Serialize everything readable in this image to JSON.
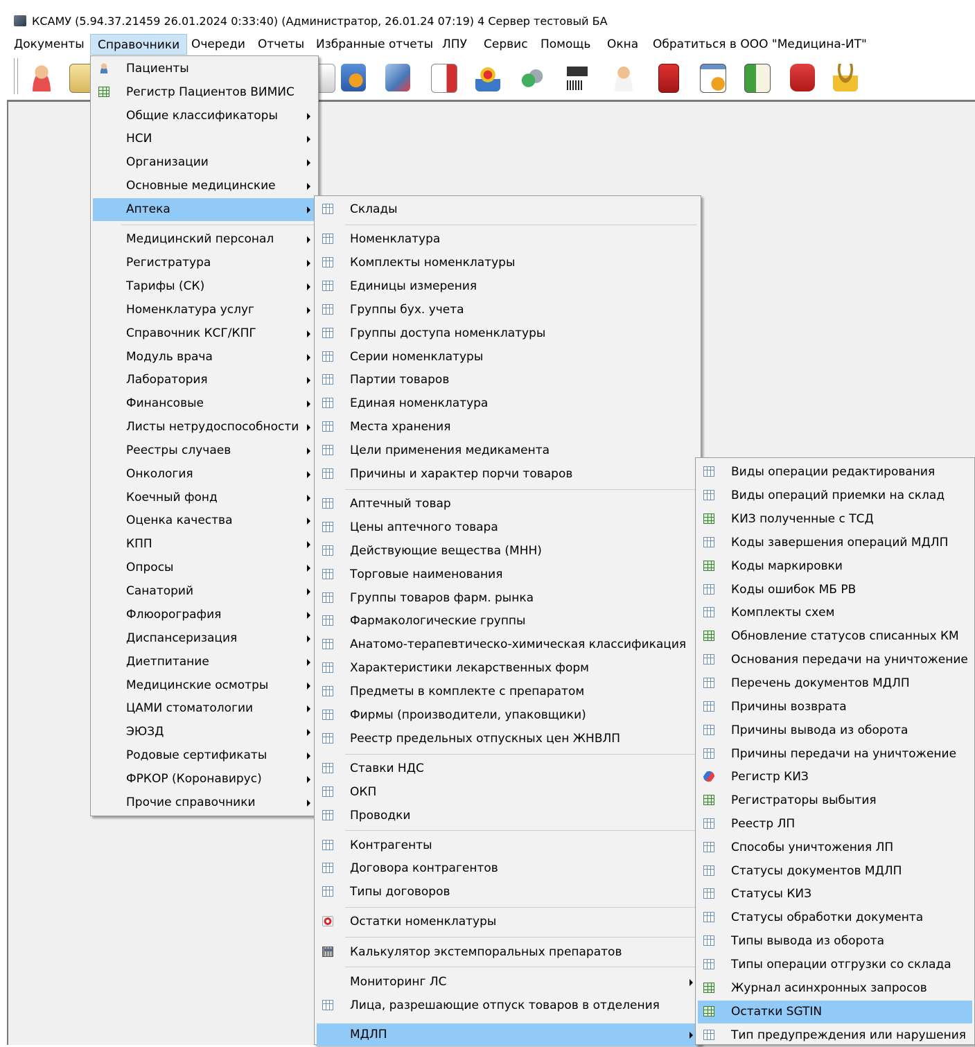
{
  "window": {
    "title": "КСАМУ (5.94.37.21459 26.01.2024 0:33:40) (Администратор, 26.01.24 07:19)  4 Сервер тестовый БА"
  },
  "menubar": [
    {
      "label": "Документы"
    },
    {
      "label": "Справочники",
      "active": true
    },
    {
      "label": "Очереди"
    },
    {
      "label": "Отчеты"
    },
    {
      "label": "Избранные отчеты"
    },
    {
      "label": "ЛПУ"
    },
    {
      "label": "Сервис"
    },
    {
      "label": "Помощь"
    },
    {
      "label": "Окна"
    },
    {
      "label": "Обратиться в ООО \"Медицина-ИТ\""
    }
  ],
  "menu1": [
    {
      "label": "Пациенты",
      "icon": "patients-icon"
    },
    {
      "label": "Регистр Пациентов ВИМИС",
      "icon": "grid-green-icon"
    },
    {
      "label": "Общие классификаторы",
      "sub": true
    },
    {
      "label": "НСИ",
      "sub": true
    },
    {
      "label": "Организации",
      "sub": true
    },
    {
      "label": "Основные медицинские",
      "sub": true
    },
    {
      "label": "Аптека",
      "sub": true,
      "selected": true
    },
    {
      "label": "Медицинский персонал",
      "sub": true
    },
    {
      "label": "Регистратура",
      "sub": true
    },
    {
      "label": "Тарифы (СК)",
      "sub": true
    },
    {
      "label": "Номенклатура услуг",
      "sub": true
    },
    {
      "label": "Справочник КСГ/КПГ",
      "sub": true
    },
    {
      "label": "Модуль врача",
      "sub": true
    },
    {
      "label": "Лаборатория",
      "sub": true
    },
    {
      "label": "Финансовые",
      "sub": true
    },
    {
      "label": "Листы нетрудоспособности",
      "sub": true
    },
    {
      "label": "Реестры случаев",
      "sub": true
    },
    {
      "label": "Онкология",
      "sub": true
    },
    {
      "label": "Коечный фонд",
      "sub": true
    },
    {
      "label": "Оценка качества",
      "sub": true
    },
    {
      "label": "КПП",
      "sub": true
    },
    {
      "label": "Опросы",
      "sub": true
    },
    {
      "label": "Санаторий",
      "sub": true
    },
    {
      "label": "Флюорография",
      "sub": true
    },
    {
      "label": "Диспансеризация",
      "sub": true
    },
    {
      "label": "Диетпитание",
      "sub": true
    },
    {
      "label": "Медицинские осмотры",
      "sub": true
    },
    {
      "label": "ЦАМИ стоматологии",
      "sub": true
    },
    {
      "label": "ЭЮЗД",
      "sub": true
    },
    {
      "label": "Родовые сертификаты",
      "sub": true
    },
    {
      "label": "ФРКОР (Коронавирус)",
      "sub": true
    },
    {
      "label": "Прочие справочники",
      "sub": true
    }
  ],
  "menu2": [
    {
      "label": "Склады",
      "icon": "grid-icon"
    },
    {
      "label": "Номенклатура",
      "icon": "grid-icon"
    },
    {
      "label": "Комплекты номенклатуры",
      "icon": "grid-icon"
    },
    {
      "label": "Единицы измерения",
      "icon": "grid-icon"
    },
    {
      "label": "Группы бух. учета",
      "icon": "grid-icon"
    },
    {
      "label": "Группы доступа номенклатуры",
      "icon": "grid-icon"
    },
    {
      "label": "Серии номенклатуры",
      "icon": "grid-icon"
    },
    {
      "label": "Партии товаров",
      "icon": "grid-icon"
    },
    {
      "label": "Единая номенклатура",
      "icon": "grid-icon"
    },
    {
      "label": "Места хранения",
      "icon": "grid-icon"
    },
    {
      "label": "Цели применения медикамента",
      "icon": "grid-icon"
    },
    {
      "label": "Причины и характер порчи товаров",
      "icon": "grid-icon"
    },
    {
      "label": "Аптечный товар",
      "icon": "grid-icon"
    },
    {
      "label": "Цены аптечного товара",
      "icon": "grid-icon"
    },
    {
      "label": "Действующие вещества (МНН)",
      "icon": "grid-icon"
    },
    {
      "label": "Торговые наименования",
      "icon": "grid-icon"
    },
    {
      "label": "Группы товаров фарм. рынка",
      "icon": "grid-icon"
    },
    {
      "label": "Фармакологические группы",
      "icon": "grid-icon"
    },
    {
      "label": "Анатомо-терапевтическо-химическая классификация",
      "icon": "grid-icon"
    },
    {
      "label": "Характеристики лекарственных форм",
      "icon": "grid-icon"
    },
    {
      "label": "Предметы в комплекте с препаратом",
      "icon": "grid-icon"
    },
    {
      "label": "Фирмы (производители, упаковщики)",
      "icon": "grid-icon"
    },
    {
      "label": "Реестр предельных отпускных цен ЖНВЛП",
      "icon": "grid-icon"
    },
    {
      "label": "Ставки НДС",
      "icon": "grid-icon"
    },
    {
      "label": "ОКП",
      "icon": "grid-icon"
    },
    {
      "label": "Проводки",
      "icon": "grid-icon"
    },
    {
      "label": "Контрагенты",
      "icon": "grid-icon"
    },
    {
      "label": "Договора контрагентов",
      "icon": "grid-icon"
    },
    {
      "label": "Типы договоров",
      "icon": "grid-icon"
    },
    {
      "label": "Остатки номенклатуры",
      "icon": "record-icon"
    },
    {
      "label": "Калькулятор экстемпоральных препаратов",
      "icon": "calculator-icon"
    },
    {
      "label": "Мониторинг ЛС",
      "sub": true
    },
    {
      "label": "Лица, разрешающие отпуск товаров в отделения",
      "icon": "grid-icon"
    },
    {
      "label": "МДЛП",
      "sub": true,
      "selected": true
    }
  ],
  "menu3": [
    {
      "label": "Виды операции редактирования",
      "icon": "grid-icon"
    },
    {
      "label": "Виды операций приемки на склад",
      "icon": "grid-icon"
    },
    {
      "label": "КИЗ полученные с ТСД",
      "icon": "grid-green-icon"
    },
    {
      "label": "Коды завершения операций МДЛП",
      "icon": "grid-icon"
    },
    {
      "label": "Коды маркировки",
      "icon": "grid-green-icon"
    },
    {
      "label": "Коды ошибок МБ РВ",
      "icon": "grid-icon"
    },
    {
      "label": "Комплекты схем",
      "icon": "grid-icon"
    },
    {
      "label": "Обновление статусов списанных КМ",
      "icon": "grid-green-icon"
    },
    {
      "label": "Основания передачи на уничтожение",
      "icon": "grid-icon"
    },
    {
      "label": "Перечень документов МДЛП",
      "icon": "grid-icon"
    },
    {
      "label": "Причины возврата",
      "icon": "grid-icon"
    },
    {
      "label": "Причины вывода из оборота",
      "icon": "grid-icon"
    },
    {
      "label": "Причины передачи на уничтожение",
      "icon": "grid-icon"
    },
    {
      "label": "Регистр КИЗ",
      "icon": "pill-icon"
    },
    {
      "label": "Регистраторы выбытия",
      "icon": "grid-green-icon"
    },
    {
      "label": "Реестр ЛП",
      "icon": "grid-icon"
    },
    {
      "label": "Способы уничтожения ЛП",
      "icon": "grid-icon"
    },
    {
      "label": "Статусы документов МДЛП",
      "icon": "grid-icon"
    },
    {
      "label": "Статусы КИЗ",
      "icon": "grid-icon"
    },
    {
      "label": "Статусы обработки документа",
      "icon": "grid-icon"
    },
    {
      "label": "Типы вывода из оборота",
      "icon": "grid-icon"
    },
    {
      "label": "Типы операции отгрузки со склада",
      "icon": "grid-icon"
    },
    {
      "label": "Журнал асинхронных запросов",
      "icon": "grid-green-icon"
    },
    {
      "label": "Остатки SGTIN",
      "icon": "grid-green-icon",
      "selected": true
    },
    {
      "label": "Тип предупреждения или нарушения",
      "icon": "grid-icon"
    }
  ],
  "colors": {
    "highlight": "#91c9f7",
    "menu_bg": "#f2f2f2",
    "menubar_active": "#cce4f7"
  }
}
